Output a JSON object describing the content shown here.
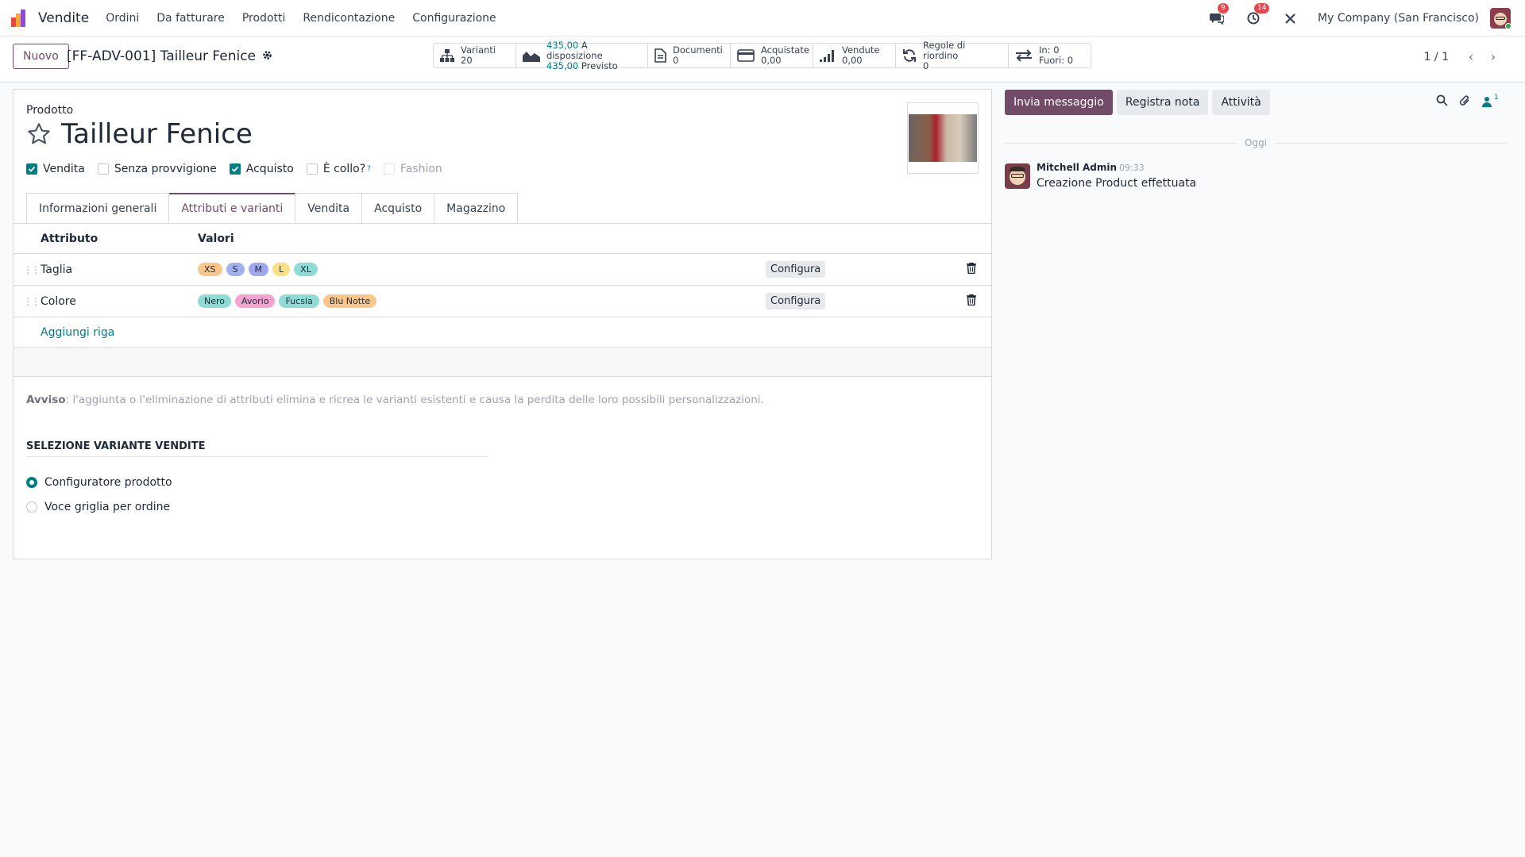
{
  "app": {
    "name": "Vendite"
  },
  "menu": [
    "Ordini",
    "Da fatturare",
    "Prodotti",
    "Rendicontazione",
    "Configurazione"
  ],
  "nav_right": {
    "messages_badge": "9",
    "activities_badge": "14",
    "company": "My Company (San Francisco)"
  },
  "control_panel": {
    "new_button": "Nuovo",
    "breadcrumb": "[FF-ADV-001] Tailleur Fenice",
    "pager": "1 / 1",
    "smart_buttons": [
      {
        "label": "Varianti",
        "value": "20"
      },
      {
        "label": "A disposizione",
        "value": "435,00",
        "sub_value": "435,00",
        "sub_label": "Previsto"
      },
      {
        "label": "Documenti",
        "value": "0"
      },
      {
        "label": "Acquistate",
        "value": "0,00"
      },
      {
        "label": "Vendute",
        "value": "0,00"
      },
      {
        "label": "Regole di riordino",
        "value": "0"
      },
      {
        "label": "In: 0",
        "value": "Fuori: 0"
      }
    ]
  },
  "form": {
    "product_label": "Prodotto",
    "product_name": "Tailleur Fenice",
    "checkboxes": [
      {
        "label": "Vendita",
        "checked": true
      },
      {
        "label": "Senza provvigione",
        "checked": false
      },
      {
        "label": "Acquisto",
        "checked": true
      },
      {
        "label": "È collo?",
        "checked": false,
        "help": "?"
      },
      {
        "label": "Fashion",
        "checked": false,
        "disabled": true
      }
    ],
    "tabs": [
      "Informazioni generali",
      "Attributi e varianti",
      "Vendita",
      "Acquisto",
      "Magazzino"
    ],
    "active_tab": "Attributi e varianti",
    "table": {
      "headers": [
        "Attributo",
        "Valori"
      ],
      "rows": [
        {
          "attribute": "Taglia",
          "values": [
            {
              "text": "XS",
              "color": "#f9c78b"
            },
            {
              "text": "S",
              "color": "#a3b0f0"
            },
            {
              "text": "M",
              "color": "#9da7ee"
            },
            {
              "text": "L",
              "color": "#f9e083"
            },
            {
              "text": "XL",
              "color": "#8fdcd6"
            }
          ],
          "configure": "Configura"
        },
        {
          "attribute": "Colore",
          "values": [
            {
              "text": "Nero",
              "color": "#8fdcd6"
            },
            {
              "text": "Avorio",
              "color": "#f5a3d0"
            },
            {
              "text": "Fucsia",
              "color": "#8fdcd6"
            },
            {
              "text": "Blu Notte",
              "color": "#f9c78b"
            }
          ],
          "configure": "Configura"
        }
      ],
      "add_row": "Aggiungi riga"
    },
    "warning_label": "Avviso",
    "warning_text": ": l'aggiunta o l'eliminazione di attributi elimina e ricrea le varianti esistenti e causa la perdita delle loro possibili personalizzazioni.",
    "section_title": "SELEZIONE VARIANTE VENDITE",
    "radio_options": [
      {
        "label": "Configuratore prodotto",
        "selected": true
      },
      {
        "label": "Voce griglia per ordine",
        "selected": false
      }
    ]
  },
  "chatter": {
    "send_message": "Invia messaggio",
    "log_note": "Registra nota",
    "activities": "Attività",
    "followers_count": "1",
    "date_separator": "Oggi",
    "message": {
      "author": "Mitchell Admin",
      "time": "09:33",
      "body": "Creazione Product effettuata"
    }
  },
  "colors": {
    "brand": "#714b67",
    "accent": "#017e84"
  }
}
